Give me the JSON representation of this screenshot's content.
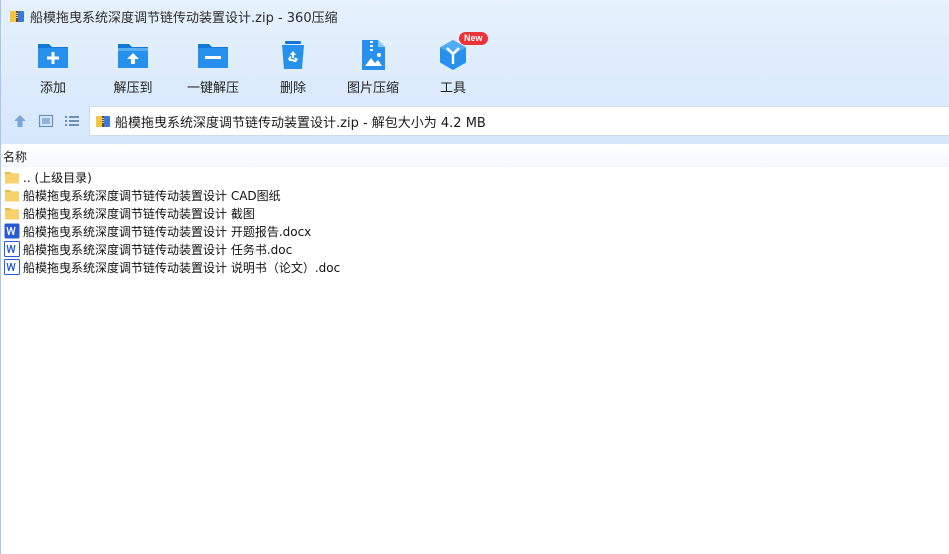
{
  "window": {
    "title": "船模拖曳系统深度调节链传动装置设计.zip - 360压缩"
  },
  "toolbar": {
    "items": [
      {
        "id": "add",
        "label": "添加",
        "icon": "folder-plus-icon"
      },
      {
        "id": "extract",
        "label": "解压到",
        "icon": "folder-upload-icon"
      },
      {
        "id": "one-click-extract",
        "label": "一键解压",
        "icon": "folder-minus-icon"
      },
      {
        "id": "delete",
        "label": "删除",
        "icon": "recycle-bin-icon"
      },
      {
        "id": "image-compress",
        "label": "图片压缩",
        "icon": "image-zip-icon"
      },
      {
        "id": "tools",
        "label": "工具",
        "icon": "tools-cube-icon",
        "badge": "New"
      }
    ]
  },
  "address": {
    "text": "船模拖曳系统深度调节链传动装置设计.zip - 解包大小为 4.2 MB"
  },
  "list": {
    "column_name": "名称",
    "rows": [
      {
        "type": "parent-folder",
        "name": ".. (上级目录)"
      },
      {
        "type": "folder",
        "name": "船模拖曳系统深度调节链传动装置设计 CAD图纸"
      },
      {
        "type": "folder",
        "name": "船模拖曳系统深度调节链传动装置设计 截图"
      },
      {
        "type": "word-docx",
        "name": "船模拖曳系统深度调节链传动装置设计 开题报告.docx"
      },
      {
        "type": "word-doc",
        "name": "船模拖曳系统深度调节链传动装置设计 任务书.doc"
      },
      {
        "type": "word-doc",
        "name": "船模拖曳系统深度调节链传动装置设计 说明书（论文）.doc"
      }
    ]
  },
  "colors": {
    "accent": "#1a8be6",
    "toolbar_bg": "#dcebfc",
    "folder": "#f7d26b",
    "word": "#2b5bd0",
    "badge": "#e8343a"
  }
}
